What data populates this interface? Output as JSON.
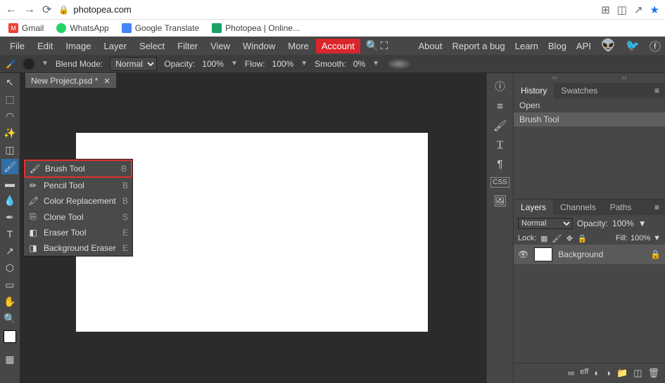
{
  "browser": {
    "url": "photopea.com",
    "bookmarks": [
      {
        "label": "Gmail",
        "icon_color": "#ea4335"
      },
      {
        "label": "WhatsApp",
        "icon_color": "#25d366"
      },
      {
        "label": "Google Translate",
        "icon_color": "#4285f4"
      },
      {
        "label": "Photopea | Online...",
        "icon_color": "#18a066"
      }
    ]
  },
  "menubar": {
    "items": [
      "File",
      "Edit",
      "Image",
      "Layer",
      "Select",
      "Filter",
      "View",
      "Window",
      "More"
    ],
    "account": "Account",
    "right": [
      "About",
      "Report a bug",
      "Learn",
      "Blog",
      "API"
    ]
  },
  "options": {
    "blend_mode_label": "Blend Mode:",
    "blend_mode_value": "Normal",
    "opacity_label": "Opacity:",
    "opacity_value": "100%",
    "flow_label": "Flow:",
    "flow_value": "100%",
    "smooth_label": "Smooth:",
    "smooth_value": "0%"
  },
  "document": {
    "tab_title": "New Project.psd *"
  },
  "tool_menu": [
    {
      "label": "Brush Tool",
      "shortcut": "B",
      "highlighted": true
    },
    {
      "label": "Pencil Tool",
      "shortcut": "B"
    },
    {
      "label": "Color Replacement",
      "shortcut": "B"
    },
    {
      "label": "Clone Tool",
      "shortcut": "S"
    },
    {
      "label": "Eraser Tool",
      "shortcut": "E"
    },
    {
      "label": "Background Eraser",
      "shortcut": "E"
    }
  ],
  "history_panel": {
    "tabs": {
      "history": "History",
      "swatches": "Swatches"
    },
    "items": [
      "Open",
      "Brush Tool"
    ]
  },
  "layers_panel": {
    "tabs": {
      "layers": "Layers",
      "channels": "Channels",
      "paths": "Paths"
    },
    "blend_value": "Normal",
    "opacity_label": "Opacity:",
    "opacity_value": "100%",
    "lock_label": "Lock:",
    "fill_label": "Fill:",
    "fill_value": "100%",
    "layer_name": "Background"
  }
}
